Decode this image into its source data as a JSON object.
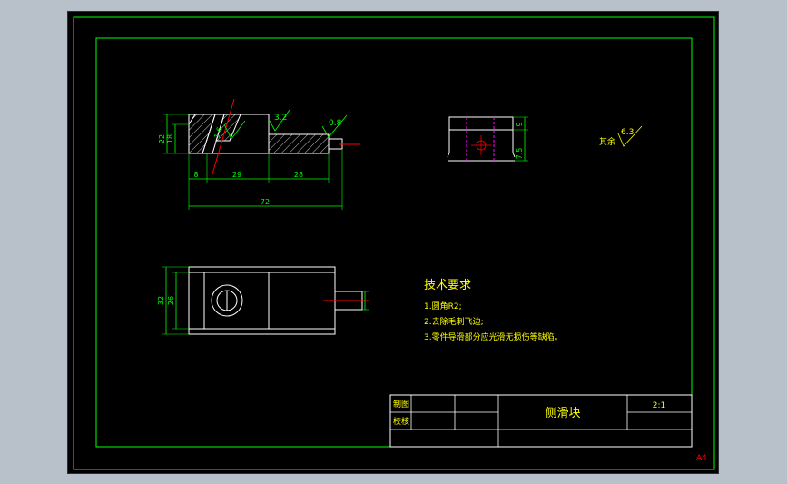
{
  "colors": {
    "background": "#b8c0c9",
    "paper": "#000000",
    "frame": "#00ff00",
    "geometry": "#ffffff",
    "dimension": "#00ff00",
    "center": "#ff0000",
    "hidden": "#ff00ff",
    "text": "#ffff00",
    "sheet_label": "#ff0000"
  },
  "front_view": {
    "dim_height_outer": "22",
    "dim_height_inner": "18",
    "dim_len_a": "8",
    "dim_len_b": "29",
    "dim_len_c": "28",
    "dim_total": "72",
    "roughness_a": "3.2",
    "roughness_b": "0.8",
    "angle_note": "1.6"
  },
  "side_view": {
    "dim_top": "9",
    "dim_bottom": "7.5"
  },
  "top_view": {
    "dim_width_outer": "32",
    "dim_width_inner": "26"
  },
  "other_roughness": {
    "label": "其余",
    "value": "6.3"
  },
  "tech_requirements": {
    "title": "技术要求",
    "items": [
      "1.圆角R2;",
      "2.去除毛刺飞边;",
      "3.零件导滑部分应光滑无损伤等缺陷。"
    ]
  },
  "title_block": {
    "row1_label": "制图",
    "row2_label": "校核",
    "part_name": "侧滑块",
    "scale": "2:1"
  },
  "sheet_size": "A4"
}
